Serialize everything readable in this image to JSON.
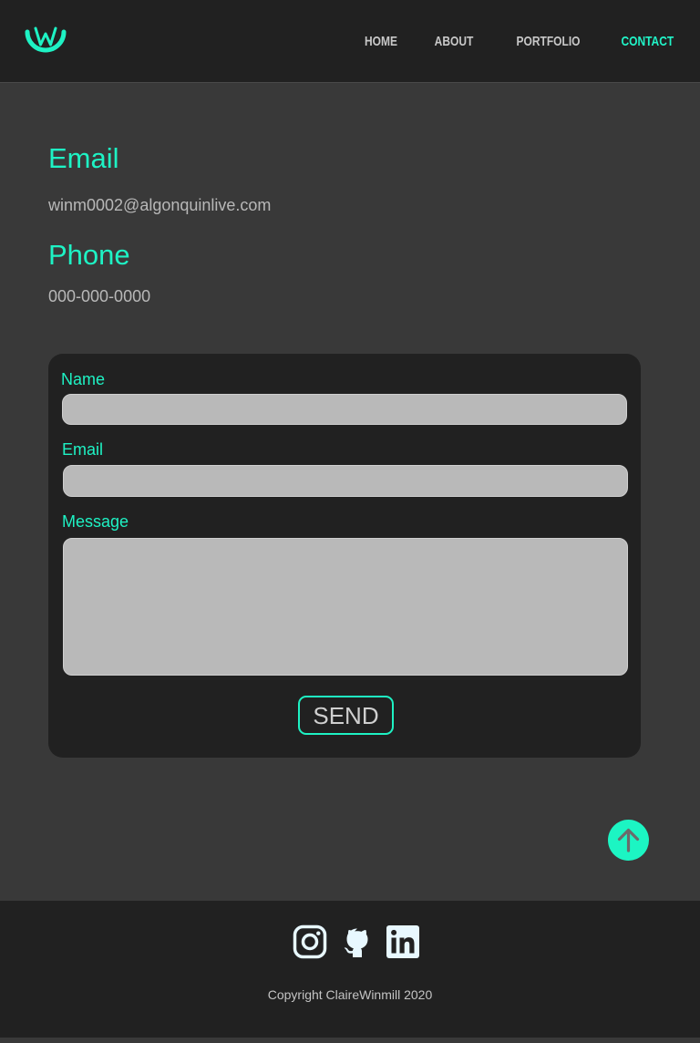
{
  "nav": {
    "items": [
      {
        "label": "HOME"
      },
      {
        "label": "ABOUT"
      },
      {
        "label": "PORTFOLIO"
      },
      {
        "label": "CONTACT",
        "active": true
      }
    ]
  },
  "contact": {
    "email_heading": "Email",
    "email_value": "winm0002@algonquinlive.com",
    "phone_heading": "Phone",
    "phone_value": "000-000-0000"
  },
  "form": {
    "name_label": "Name",
    "email_label": "Email",
    "message_label": "Message",
    "name_value": "",
    "email_value": "",
    "message_value": "",
    "send_label": "SEND"
  },
  "footer": {
    "social": [
      "instagram-icon",
      "github-icon",
      "linkedin-icon"
    ],
    "copyright": "Copyright ClaireWinmill 2020"
  },
  "colors": {
    "accent": "#1ef2c4",
    "header_bg": "#212121",
    "page_bg": "#393939",
    "input_bg": "#b9b9b9"
  }
}
